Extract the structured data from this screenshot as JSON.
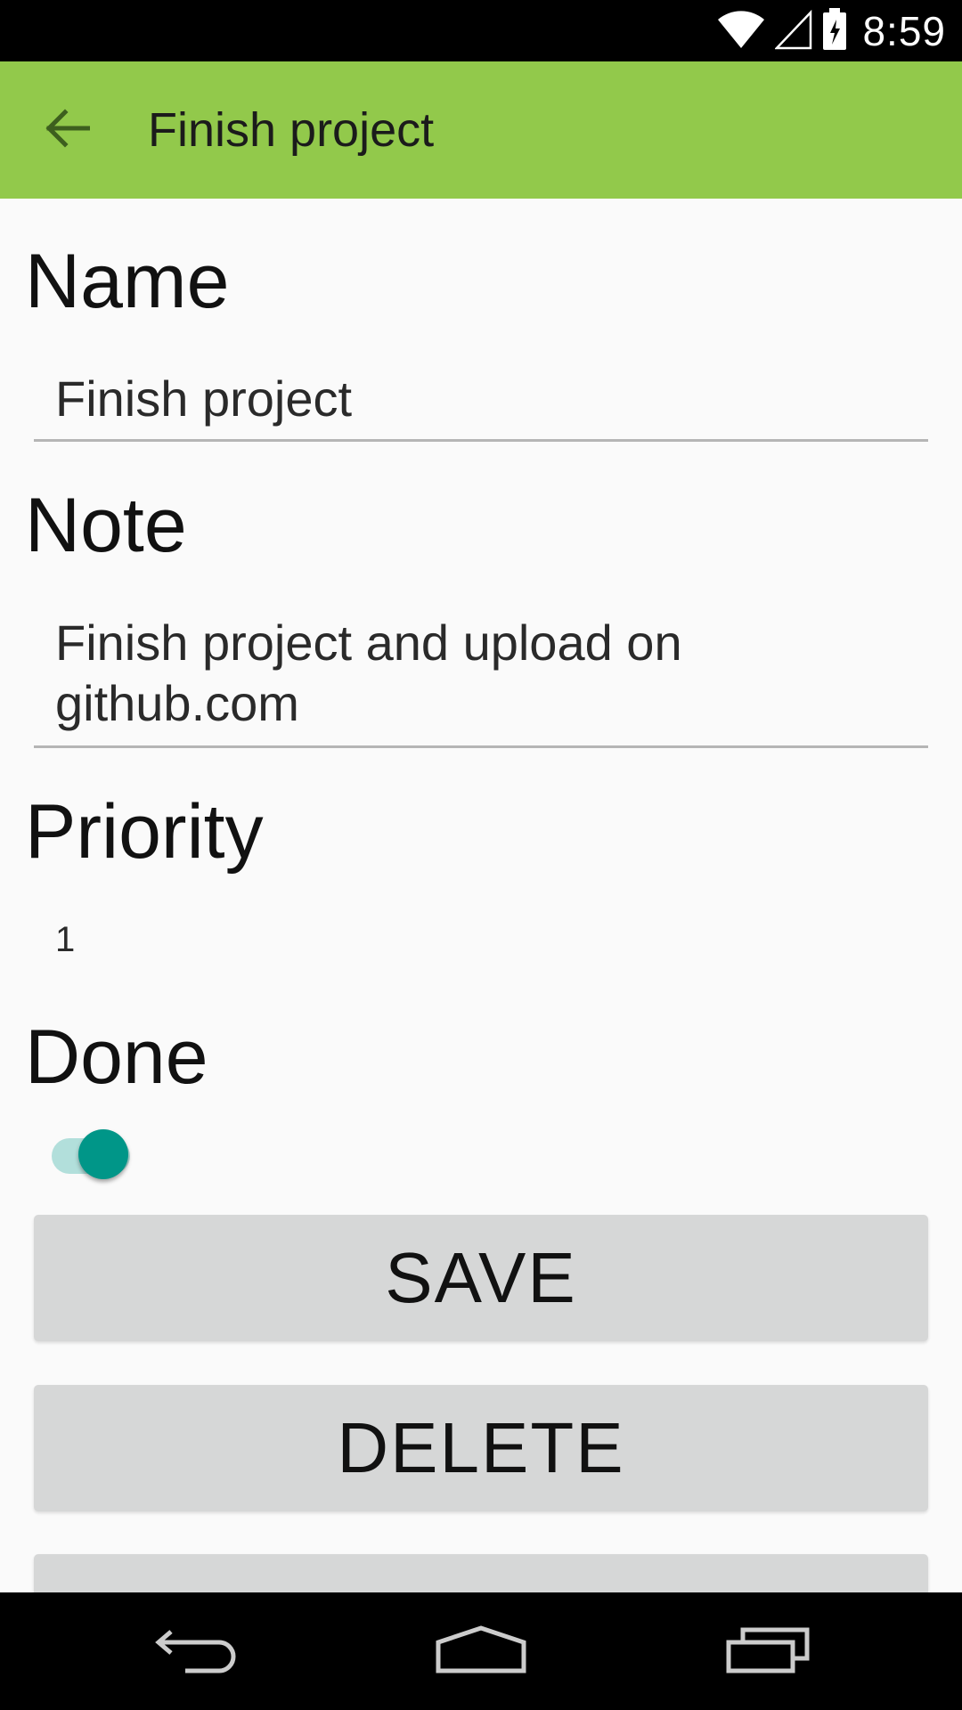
{
  "status_bar": {
    "time": "8:59",
    "icons": [
      "wifi-icon",
      "cell-signal-icon",
      "battery-icon"
    ]
  },
  "app_bar": {
    "title": "Finish project",
    "back_icon": "arrow-back-icon",
    "color": "#92c94b"
  },
  "form": {
    "name": {
      "label": "Name",
      "value": "Finish project"
    },
    "note": {
      "label": "Note",
      "value": "Finish project and upload on\ngithub.com"
    },
    "priority": {
      "label": "Priority",
      "value": "1"
    },
    "done": {
      "label": "Done",
      "checked": true,
      "accent": "#009688"
    }
  },
  "buttons": {
    "save_label": "SAVE",
    "delete_label": "DELETE"
  },
  "nav_bar": {
    "icons": [
      "nav-back-icon",
      "nav-home-icon",
      "nav-recents-icon"
    ]
  }
}
